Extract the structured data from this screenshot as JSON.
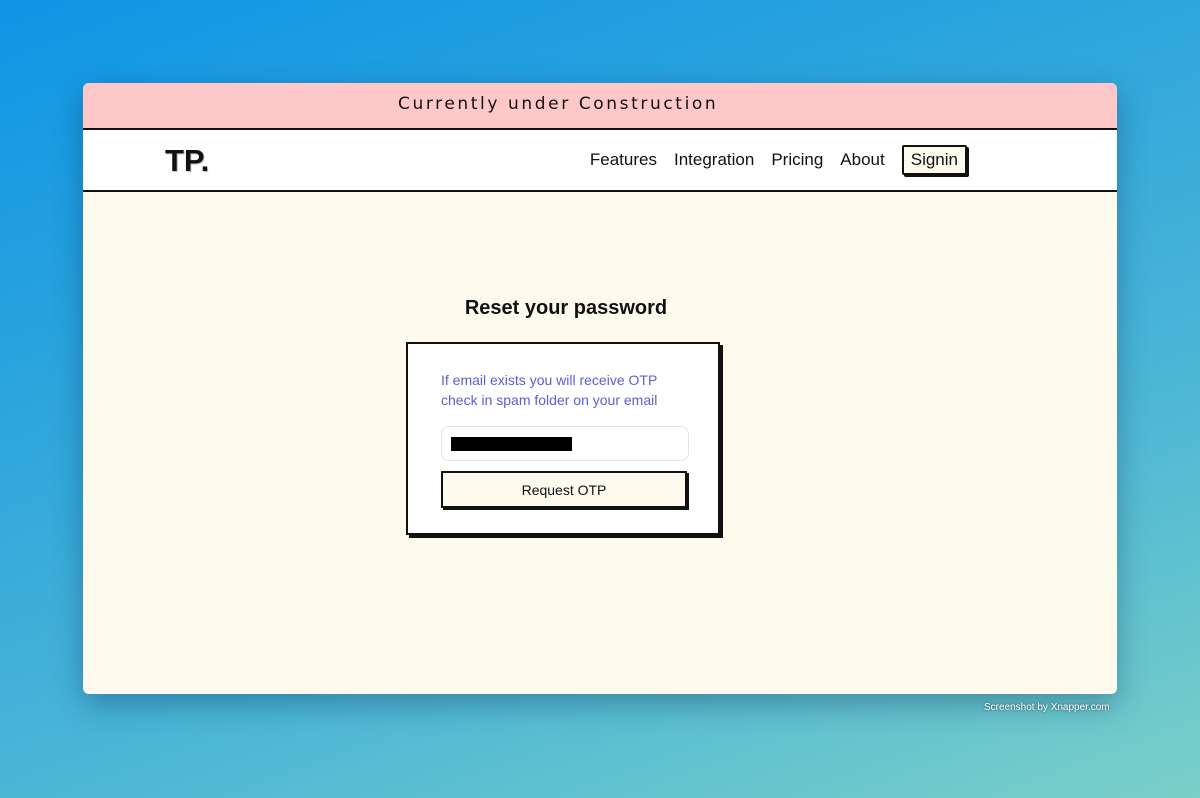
{
  "banner": {
    "text": "Currently under Construction",
    "background_color": "#fec8c8"
  },
  "navbar": {
    "logo": "TP.",
    "links": [
      {
        "label": "Features"
      },
      {
        "label": "Integration"
      },
      {
        "label": "Pricing"
      },
      {
        "label": "About"
      }
    ],
    "signin_label": "Signin"
  },
  "main": {
    "title": "Reset your password",
    "message_line1": "If email exists you will receive OTP",
    "message_line2": "check in spam folder on your email",
    "message_color": "#5a5ed8",
    "email_value_redacted": true,
    "request_button_label": "Request OTP",
    "background_color": "#fefaed"
  },
  "watermark": {
    "text": "Screenshot by Xnapper.com"
  }
}
